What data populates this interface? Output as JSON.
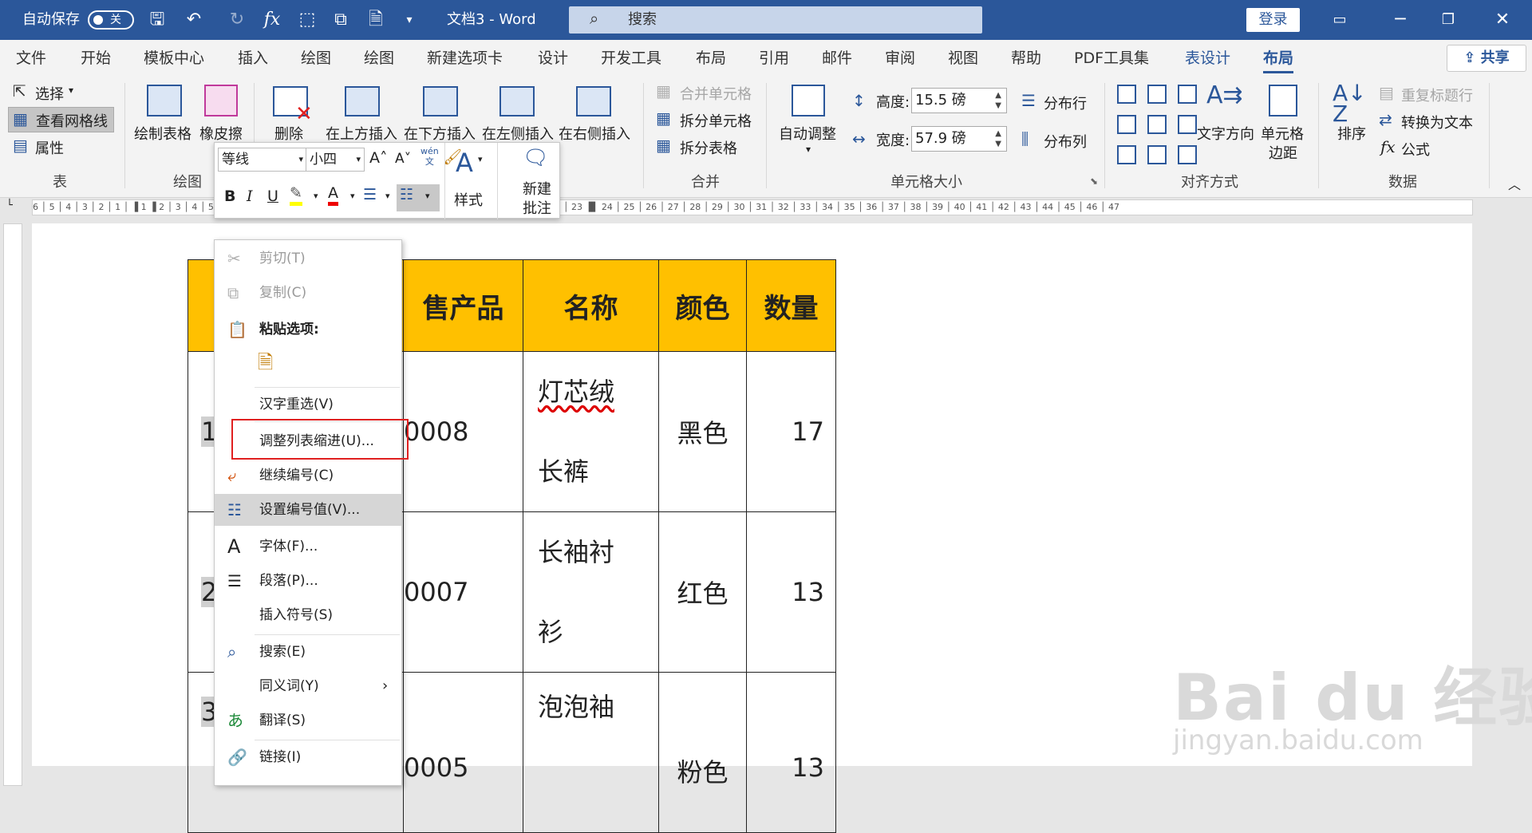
{
  "titlebar": {
    "autosave_label": "自动保存",
    "autosave_state": "关",
    "doc_title": "文档3 - Word",
    "search_placeholder": "搜索",
    "login_label": "登录"
  },
  "tabs": [
    "文件",
    "开始",
    "模板中心",
    "插入",
    "绘图",
    "绘图",
    "新建选项卡",
    "设计",
    "开发工具",
    "布局",
    "引用",
    "邮件",
    "审阅",
    "视图",
    "帮助",
    "PDF工具集",
    "表设计",
    "布局"
  ],
  "share_label": "共享",
  "ribbon": {
    "table_group": {
      "select": "选择",
      "view_gridlines": "查看网格线",
      "properties": "属性",
      "label": "表"
    },
    "draw_group": {
      "draw_table": "绘制表格",
      "eraser": "橡皮擦",
      "label": "绘图"
    },
    "rowcol_group": {
      "delete": "删除",
      "insert_above": "在上方插入",
      "insert_below": "在下方插入",
      "insert_left": "在左侧插入",
      "insert_right": "在右侧插入"
    },
    "merge_group": {
      "merge_cells": "合并单元格",
      "split_cells": "拆分单元格",
      "split_table": "拆分表格",
      "label": "合并"
    },
    "cellsize_group": {
      "autofit": "自动调整",
      "height_label": "高度:",
      "height_value": "15.5 磅",
      "width_label": "宽度:",
      "width_value": "57.9 磅",
      "distribute_rows": "分布行",
      "distribute_cols": "分布列",
      "label": "单元格大小"
    },
    "align_group": {
      "text_direction": "文字方向",
      "cell_margins_1": "单元格",
      "cell_margins_2": "边距",
      "label": "对齐方式"
    },
    "data_group": {
      "sort": "排序",
      "repeat_header": "重复标题行",
      "convert_text": "转换为文本",
      "formula": "公式",
      "label": "数据"
    }
  },
  "minitoolbar": {
    "font": "等线",
    "size": "小四",
    "wen": "wén",
    "wen2": "文",
    "styles": "样式",
    "new_comment_1": "新建",
    "new_comment_2": "批注"
  },
  "ruler_text": "6 │ 5 │ 4 │ 3 │ 2 │ 1 │ ▐ 1 ▐ 2 │ 3 │ 4 │ 5 │ 6 │ 7 │ 8 │ 9 │ 10 │ 11 │ 12 │ 13 │ 14 │ 15 │ 16 ▐▌ 18 │ 19 │ 20 ▐▌ 21 │ 22 │ 23 ▐▌ 24 │ 25 │ 26 │ 27 │ 28 │ 29 │ 30 │ 31 │ 32 │ 33 │ 34 │ 35 │ 36 │ 37 │ 38 │ 39 │ 40 │ 41 │ 42 │ 43 │ 44 │ 45 │ 46 │ 47",
  "table": {
    "headers": [
      "",
      "售产品",
      "名称",
      "颜色",
      "数量"
    ],
    "rows": [
      {
        "num": "1",
        "code": "0008",
        "name1": "灯芯绒",
        "name2": "长裤",
        "color": "黑色",
        "qty": "17"
      },
      {
        "num": "2",
        "code": "0007",
        "name1": "长袖衬",
        "name2": "衫",
        "color": "红色",
        "qty": "13"
      },
      {
        "num": "3",
        "code": "0005",
        "name1": "泡泡袖",
        "name2": "",
        "color": "粉色",
        "qty": "13"
      }
    ]
  },
  "context_menu": {
    "cut": "剪切(T)",
    "copy": "复制(C)",
    "paste_options": "粘贴选项:",
    "reconvert": "汉字重选(V)",
    "adjust_indent": "调整列表缩进(U)...",
    "continue_numbering": "继续编号(C)",
    "set_numbering_value": "设置编号值(V)...",
    "font": "字体(F)...",
    "paragraph": "段落(P)...",
    "insert_symbol": "插入符号(S)",
    "search": "搜索(E)",
    "synonyms": "同义词(Y)",
    "translate": "翻译(S)",
    "link": "链接(I)"
  },
  "watermark": {
    "big": "Bai du 经验",
    "small": "jingyan.baidu.com"
  },
  "colors": {
    "title_blue": "#2b579a",
    "header_fill": "#ffc000",
    "highlight_box": "#e02020"
  }
}
